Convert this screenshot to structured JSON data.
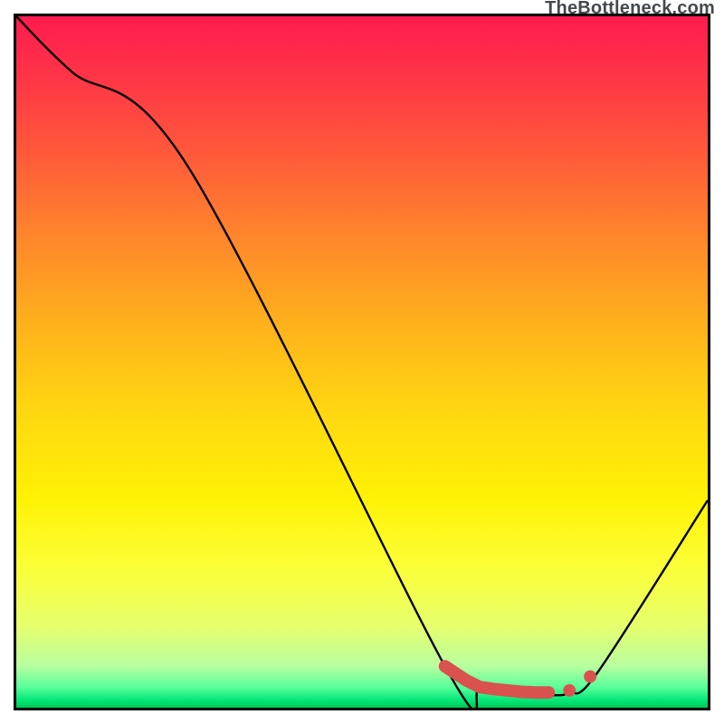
{
  "watermark": "TheBottleneck.com",
  "colors": {
    "curve_stroke": "#000000",
    "marker_fill": "#d9524e",
    "border": "#000000"
  },
  "chart_data": {
    "type": "line",
    "title": "",
    "xlabel": "",
    "ylabel": "",
    "xlim": [
      0,
      100
    ],
    "ylim": [
      0,
      100
    ],
    "grid": false,
    "series": [
      {
        "name": "curve",
        "x": [
          0,
          8,
          25,
          62,
          67,
          71,
          75,
          78,
          80,
          84,
          100
        ],
        "values": [
          100,
          92,
          78,
          6,
          2.5,
          2,
          1.8,
          1.8,
          2.2,
          5,
          30
        ]
      }
    ],
    "markers": {
      "name": "bottom-markers",
      "x": [
        62,
        65,
        67,
        69,
        71,
        73,
        75,
        77,
        80,
        83
      ],
      "values": [
        6,
        4,
        3,
        2.7,
        2.5,
        2.3,
        2.2,
        2.2,
        2.5,
        4.5
      ]
    }
  }
}
